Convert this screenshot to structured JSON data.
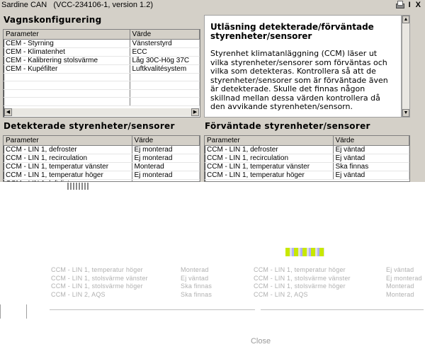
{
  "window": {
    "app_name": "Sardine CAN",
    "version": "(VCC-234106-1, version 1.2)",
    "icons": [
      "printer-icon",
      "info-icon",
      "close-icon"
    ],
    "info_glyph": "I",
    "close_glyph": "X"
  },
  "vehicle_config": {
    "title": "Vagnskonfigurering",
    "columns": [
      "Parameter",
      "Värde"
    ],
    "rows": [
      [
        "CEM - Styrning",
        "Vänsterstyrd"
      ],
      [
        "CEM - Klimatenhet",
        "ECC"
      ],
      [
        "CEM - Kalibrering stolsvärme",
        "Låg 30C-Hög 37C"
      ],
      [
        "CEM - Kupéfilter",
        "Luftkvalitésystem"
      ]
    ]
  },
  "info": {
    "title": "Utläsning detekterade/förväntade styrenheter/sensorer",
    "text": "Styrenhet klimatanläggning (CCM) läser ut vilka styrenheter/sensorer som förväntas och vilka som detekteras. Kontrollera så att de styrenheter/sensorer som är förväntade även är detekterade. Skulle det finnas någon skillnad mellan dessa värden kontrollera då den avvikande styrenheten/sensorn."
  },
  "detected": {
    "title": "Detekterade styrenheter/sensorer",
    "columns": [
      "Parameter",
      "Värde"
    ],
    "rows": [
      [
        "CCM - LIN 1, defroster",
        "Ej monterad"
      ],
      [
        "CCM - LIN 1, recirculation",
        "Ej monterad"
      ],
      [
        "CCM - LIN 1, temperatur vänster",
        "Monterad"
      ],
      [
        "CCM - LIN 1, temperatur höger",
        "Ej monterad"
      ],
      [
        "CCM - LIN 1, luftdist",
        ""
      ],
      [
        "CCM - LIN 1, stols",
        ""
      ]
    ]
  },
  "expected": {
    "title": "Förväntade styrenheter/sensorer",
    "columns": [
      "Parameter",
      "Värde"
    ],
    "rows": [
      [
        "CCM - LIN 1, defroster",
        "Ej väntad"
      ],
      [
        "CCM - LIN 1, recirculation",
        "Ej väntad"
      ],
      [
        "CCM - LIN 1, temperatur vänster",
        "Ska finnas"
      ],
      [
        "CCM - LIN 1, temperatur höger",
        "Ej väntad"
      ]
    ]
  },
  "ghost_rows": {
    "left": [
      [
        "CCM - LIN 1, temperatur höger",
        "Monterad"
      ],
      [
        "CCM - LIN 1, stolsvärme vänster",
        "Ej väntad"
      ],
      [
        "CCM - LIN 1, stolsvärme höger",
        "Ska finnas"
      ],
      [
        "CCM - LIN 2, AQS",
        "Ska finnas"
      ]
    ],
    "right": [
      [
        "CCM - LIN 1, temperatur höger",
        "Ej väntad"
      ],
      [
        "CCM - LIN 1, stolsvärme vänster",
        "Ej monterad"
      ],
      [
        "CCM - LIN 1, stolsvärme höger",
        "Monterad"
      ],
      [
        "CCM - LIN 2, AQS",
        "Monterad"
      ]
    ]
  },
  "footer": {
    "close_label": "Close"
  }
}
